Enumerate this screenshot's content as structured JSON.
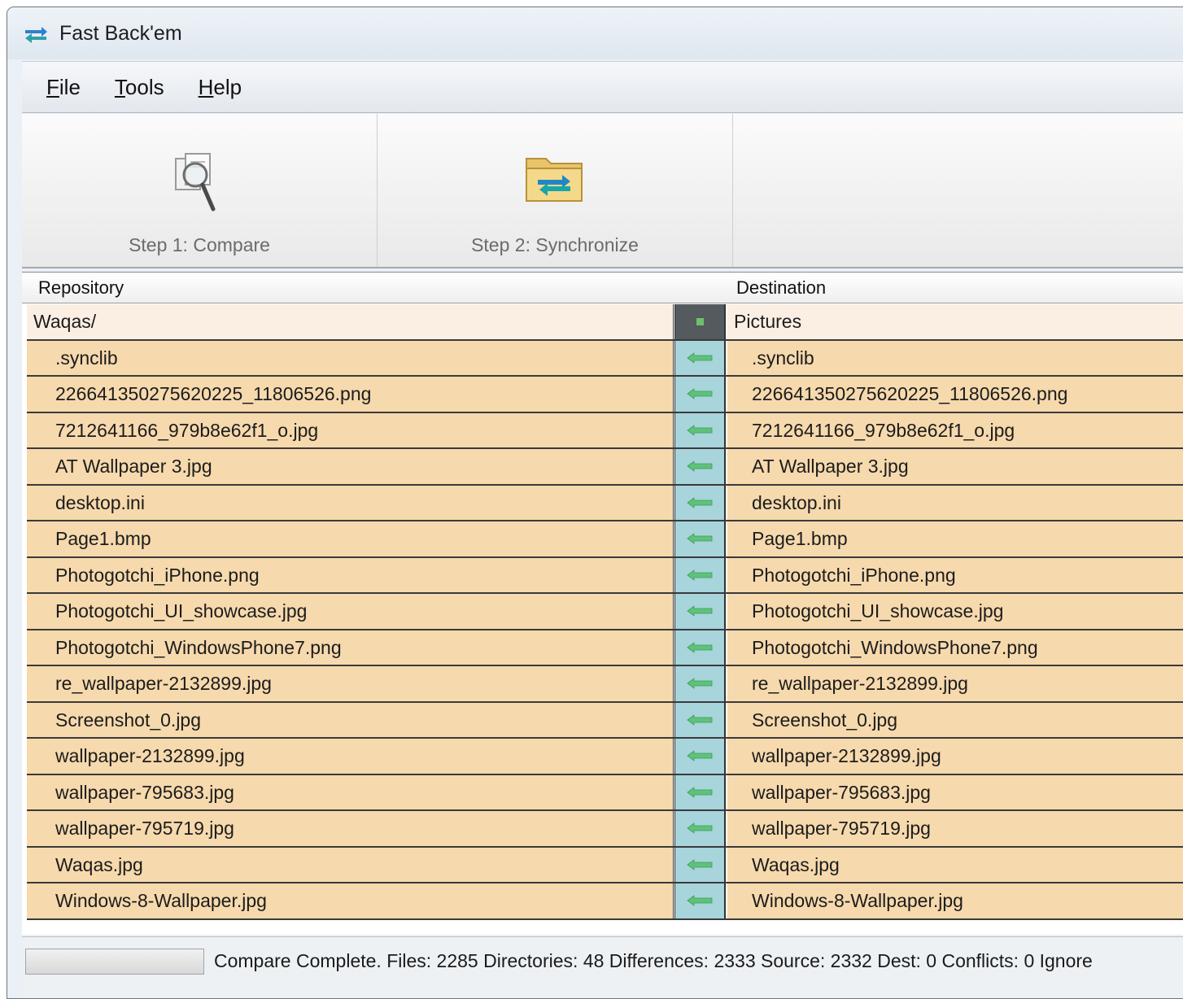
{
  "window": {
    "title": "Fast Back'em"
  },
  "menu": {
    "items": [
      {
        "label": "File",
        "accel": "F",
        "rest": "ile"
      },
      {
        "label": "Tools",
        "accel": "T",
        "rest": "ools"
      },
      {
        "label": "Help",
        "accel": "H",
        "rest": "elp"
      }
    ]
  },
  "toolbar": {
    "compare_label": "Step 1: Compare",
    "sync_label": "Step 2: Synchronize"
  },
  "grid": {
    "header_left": "Repository",
    "header_right": "Destination",
    "root": {
      "left": "Waqas/",
      "right": "Pictures"
    },
    "rows": [
      {
        "left": ".synclib",
        "right": ".synclib"
      },
      {
        "left": "226641350275620225_11806526.png",
        "right": "226641350275620225_11806526.png"
      },
      {
        "left": "7212641166_979b8e62f1_o.jpg",
        "right": "7212641166_979b8e62f1_o.jpg"
      },
      {
        "left": "AT Wallpaper 3.jpg",
        "right": "AT Wallpaper 3.jpg"
      },
      {
        "left": "desktop.ini",
        "right": "desktop.ini"
      },
      {
        "left": "Page1.bmp",
        "right": "Page1.bmp"
      },
      {
        "left": "Photogotchi_iPhone.png",
        "right": "Photogotchi_iPhone.png"
      },
      {
        "left": "Photogotchi_UI_showcase.jpg",
        "right": "Photogotchi_UI_showcase.jpg"
      },
      {
        "left": "Photogotchi_WindowsPhone7.png",
        "right": "Photogotchi_WindowsPhone7.png"
      },
      {
        "left": "re_wallpaper-2132899.jpg",
        "right": "re_wallpaper-2132899.jpg"
      },
      {
        "left": "Screenshot_0.jpg",
        "right": "Screenshot_0.jpg"
      },
      {
        "left": "wallpaper-2132899.jpg",
        "right": "wallpaper-2132899.jpg"
      },
      {
        "left": "wallpaper-795683.jpg",
        "right": "wallpaper-795683.jpg"
      },
      {
        "left": "wallpaper-795719.jpg",
        "right": "wallpaper-795719.jpg"
      },
      {
        "left": "Waqas.jpg",
        "right": "Waqas.jpg"
      },
      {
        "left": "Windows-8-Wallpaper.jpg",
        "right": "Windows-8-Wallpaper.jpg"
      }
    ],
    "direction_icon": "arrow-left-icon"
  },
  "status": {
    "text": "Compare Complete. Files: 2285 Directories: 48 Differences: 2333 Source: 2332 Dest: 0 Conflicts: 0 Ignore"
  },
  "colors": {
    "row_bg": "#f6d9ad",
    "direction_bg": "#a8d4dc",
    "arrow": "#5fc27a"
  }
}
